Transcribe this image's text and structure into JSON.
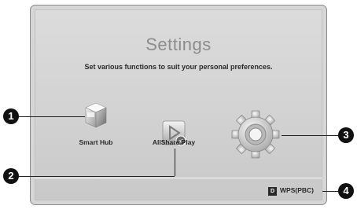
{
  "screen": {
    "title": "Settings",
    "subtitle": "Set various functions to suit your personal preferences."
  },
  "apps": [
    {
      "label": "Smart Hub",
      "icon": "smart-hub-cube-icon"
    },
    {
      "label": "AllShare Play",
      "icon": "allshare-play-icon"
    },
    {
      "label": "",
      "icon": "settings-gear-icon"
    }
  ],
  "status": {
    "badge": "D",
    "label": "WPS(PBC)"
  },
  "callouts": [
    "1",
    "2",
    "3",
    "4"
  ]
}
